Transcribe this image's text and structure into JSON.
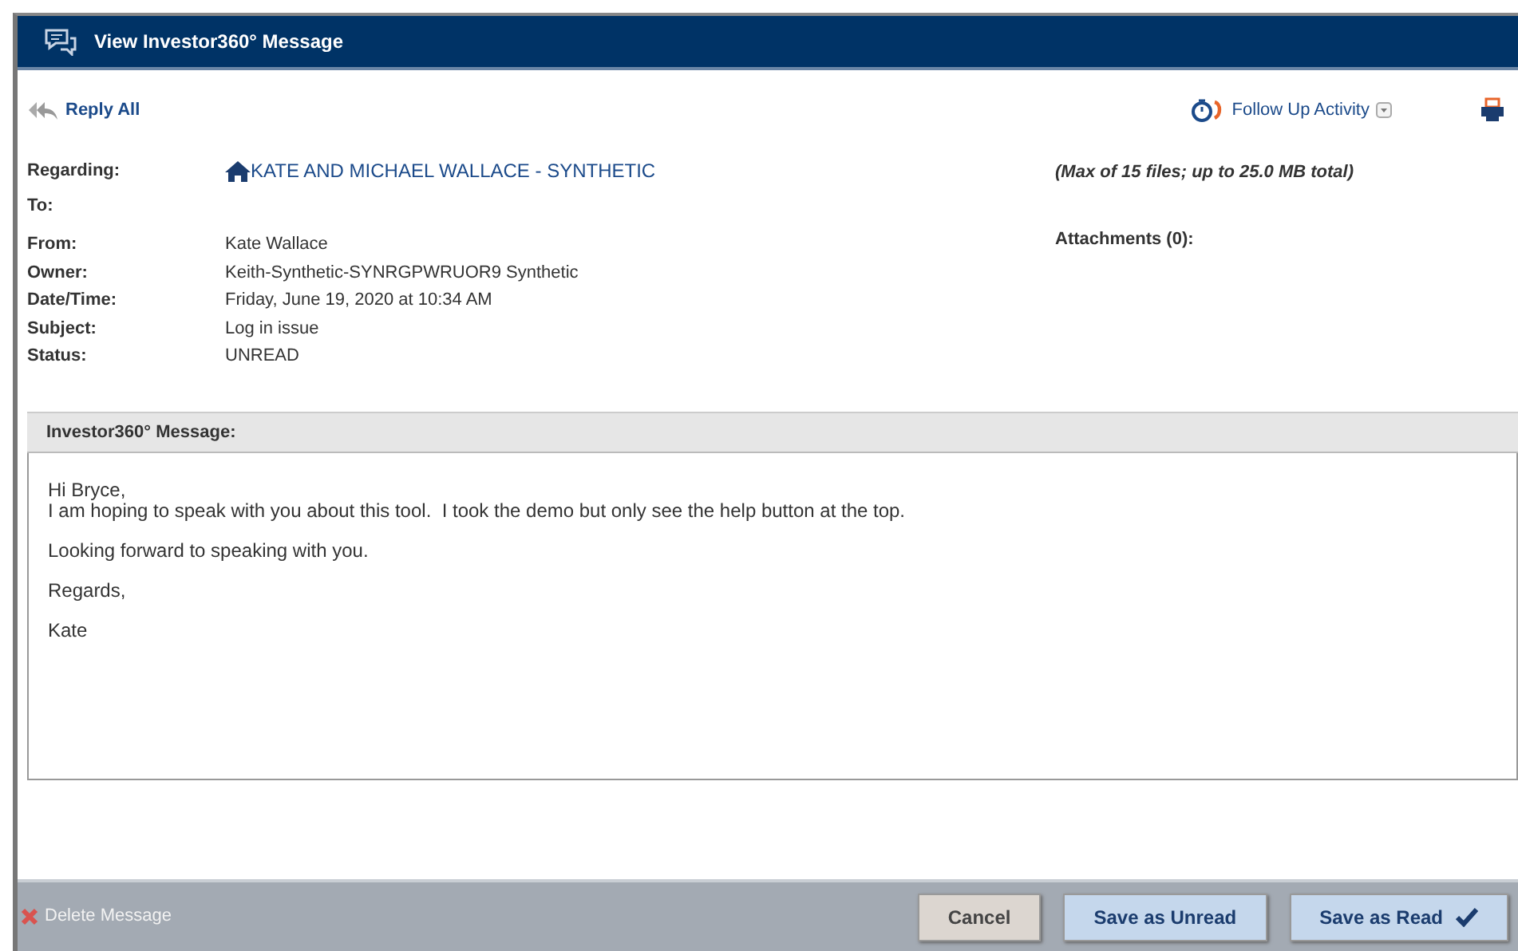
{
  "window": {
    "title": "View Investor360° Message"
  },
  "toolbar": {
    "reply_all": "Reply All",
    "follow_up": "Follow Up Activity"
  },
  "fields": [
    {
      "label": "Regarding:",
      "value": "KATE AND MICHAEL WALLACE - SYNTHETIC",
      "kind": "link"
    },
    {
      "label": "To:",
      "kind": "text"
    },
    {
      "label": "From:",
      "value": "Kate Wallace",
      "kind": "text"
    },
    {
      "label": "Owner:",
      "value": "Keith-Synthetic-SYNRGPWRUOR9 Synthetic",
      "kind": "text"
    },
    {
      "label": "Date/Time:",
      "value": "Friday, June 19, 2020 at 10:34 AM",
      "kind": "text"
    },
    {
      "label": "Subject:",
      "value": "Log in issue",
      "kind": "text"
    },
    {
      "label": "Status:",
      "value": "UNREAD",
      "kind": "text"
    }
  ],
  "attachments": {
    "limit_note": "(Max of 15 files; up to 25.0 MB total)",
    "label": "Attachments (0):"
  },
  "message": {
    "header": "Investor360° Message:",
    "paragraphs": [
      [
        "Hi Bryce,",
        "I am hoping to speak with you about this tool.  I took the demo but only see the help button at the top."
      ],
      [
        "Looking forward to speaking with you."
      ],
      [
        "Regards,"
      ],
      [
        "Kate"
      ]
    ]
  },
  "footer": {
    "delete": "Delete Message",
    "buttons": [
      {
        "label": "Cancel",
        "kind": "cancel"
      },
      {
        "label": "Save as Unread",
        "kind": "save"
      },
      {
        "label": "Save as Read",
        "kind": "save_check"
      }
    ]
  }
}
